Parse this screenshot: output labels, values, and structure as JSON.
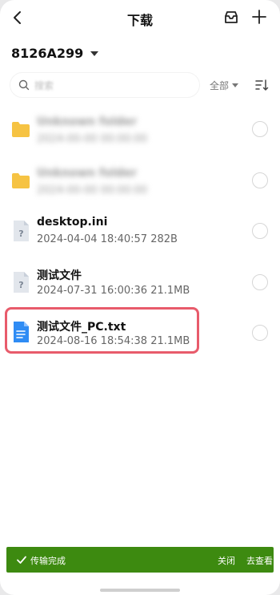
{
  "header": {
    "title": "下载"
  },
  "device": {
    "name": "8126A299"
  },
  "search": {
    "placeholder": "搜索"
  },
  "filter": {
    "label": "全部"
  },
  "files": [
    {
      "type": "folder",
      "name": "Unknown folder",
      "meta": "2024-00-00 00:00:00"
    },
    {
      "type": "folder",
      "name": "Unknown folder",
      "meta": "2024-00-00 00:00:00"
    },
    {
      "type": "file-unknown",
      "name": "desktop.ini",
      "meta": "2024-04-04 18:40:57  282B"
    },
    {
      "type": "file-unknown",
      "name": "测试文件",
      "meta": "2024-07-31 16:00:36  21.1MB"
    },
    {
      "type": "file-text",
      "name": "测试文件_PC.txt",
      "meta": "2024-08-16 18:54:38  21.1MB"
    }
  ],
  "toast": {
    "message": "传输完成",
    "close_label": "关闭",
    "view_label": "去查看"
  },
  "colors": {
    "folder": "#f6c343",
    "text_file": "#2f8cf4",
    "toast_bg": "#3d8a10",
    "highlight": "#e85b6b"
  },
  "icons": {
    "back": "chevron-left-icon",
    "tray": "inbox-icon",
    "add": "plus-icon",
    "search": "search-icon",
    "sort": "sort-icon",
    "folder": "folder-icon",
    "unknown_file": "unknown-file-icon",
    "text_file": "text-file-icon",
    "check": "check-icon"
  }
}
